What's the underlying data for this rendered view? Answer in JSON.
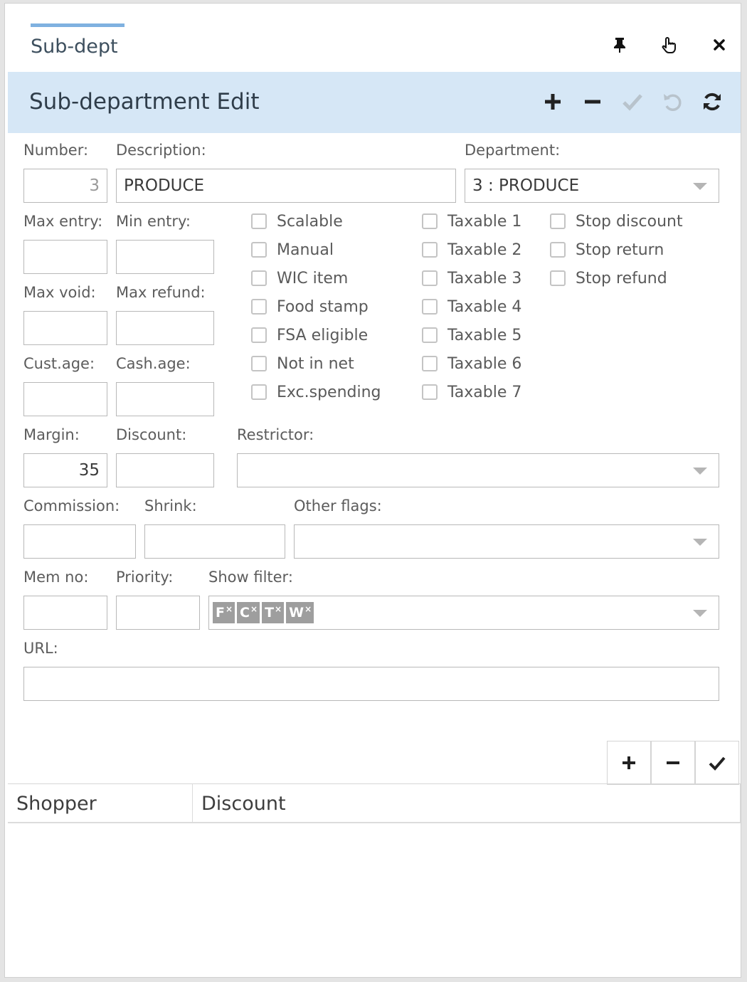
{
  "tab": {
    "title": "Sub-dept"
  },
  "window_icons": {
    "pin": "pin-icon",
    "hand": "hand-pointer-icon",
    "close": "close-icon"
  },
  "toolbar": {
    "title": "Sub-department Edit",
    "icons": [
      "plus-icon",
      "minus-icon",
      "check-icon",
      "undo-icon",
      "refresh-icon"
    ]
  },
  "form": {
    "number": {
      "label": "Number:",
      "value": "3"
    },
    "description": {
      "label": "Description:",
      "value": "PRODUCE"
    },
    "department": {
      "label": "Department:",
      "value": "3 : PRODUCE"
    },
    "max_entry": {
      "label": "Max entry:",
      "value": ""
    },
    "min_entry": {
      "label": "Min entry:",
      "value": ""
    },
    "max_void": {
      "label": "Max void:",
      "value": ""
    },
    "max_refund": {
      "label": "Max refund:",
      "value": ""
    },
    "cust_age": {
      "label": "Cust.age:",
      "value": ""
    },
    "cash_age": {
      "label": "Cash.age:",
      "value": ""
    },
    "margin": {
      "label": "Margin:",
      "value": "35"
    },
    "discount": {
      "label": "Discount:",
      "value": ""
    },
    "restrictor": {
      "label": "Restrictor:",
      "value": ""
    },
    "commission": {
      "label": "Commission:",
      "value": ""
    },
    "shrink": {
      "label": "Shrink:",
      "value": ""
    },
    "other_flags": {
      "label": "Other flags:",
      "value": ""
    },
    "mem_no": {
      "label": "Mem no:",
      "value": ""
    },
    "priority": {
      "label": "Priority:",
      "value": ""
    },
    "show_filter": {
      "label": "Show filter:",
      "chips": [
        "F",
        "C",
        "T",
        "W"
      ],
      "remove_mark": "×"
    },
    "url": {
      "label": "URL:",
      "value": ""
    }
  },
  "checkboxes": {
    "col1": [
      {
        "label": "Scalable",
        "checked": false
      },
      {
        "label": "Manual",
        "checked": false
      },
      {
        "label": "WIC item",
        "checked": false
      },
      {
        "label": "Food stamp",
        "checked": false
      },
      {
        "label": "FSA eligible",
        "checked": false
      },
      {
        "label": "Not in net",
        "checked": false
      },
      {
        "label": "Exc.spending",
        "checked": false
      }
    ],
    "col2": [
      {
        "label": "Taxable 1",
        "checked": false
      },
      {
        "label": "Taxable 2",
        "checked": false
      },
      {
        "label": "Taxable 3",
        "checked": false
      },
      {
        "label": "Taxable 4",
        "checked": false
      },
      {
        "label": "Taxable 5",
        "checked": false
      },
      {
        "label": "Taxable 6",
        "checked": false
      },
      {
        "label": "Taxable 7",
        "checked": false
      }
    ],
    "col3": [
      {
        "label": "Stop discount",
        "checked": false
      },
      {
        "label": "Stop return",
        "checked": false
      },
      {
        "label": "Stop refund",
        "checked": false
      }
    ]
  },
  "grid": {
    "buttons": [
      "plus-icon",
      "minus-icon",
      "check-icon"
    ],
    "columns": [
      "Shopper",
      "Discount"
    ],
    "rows": []
  },
  "colors": {
    "toolbar_bg": "#d6e7f6",
    "tab_accent": "#7fb1e0",
    "chip_bg": "#9e9e9e"
  }
}
